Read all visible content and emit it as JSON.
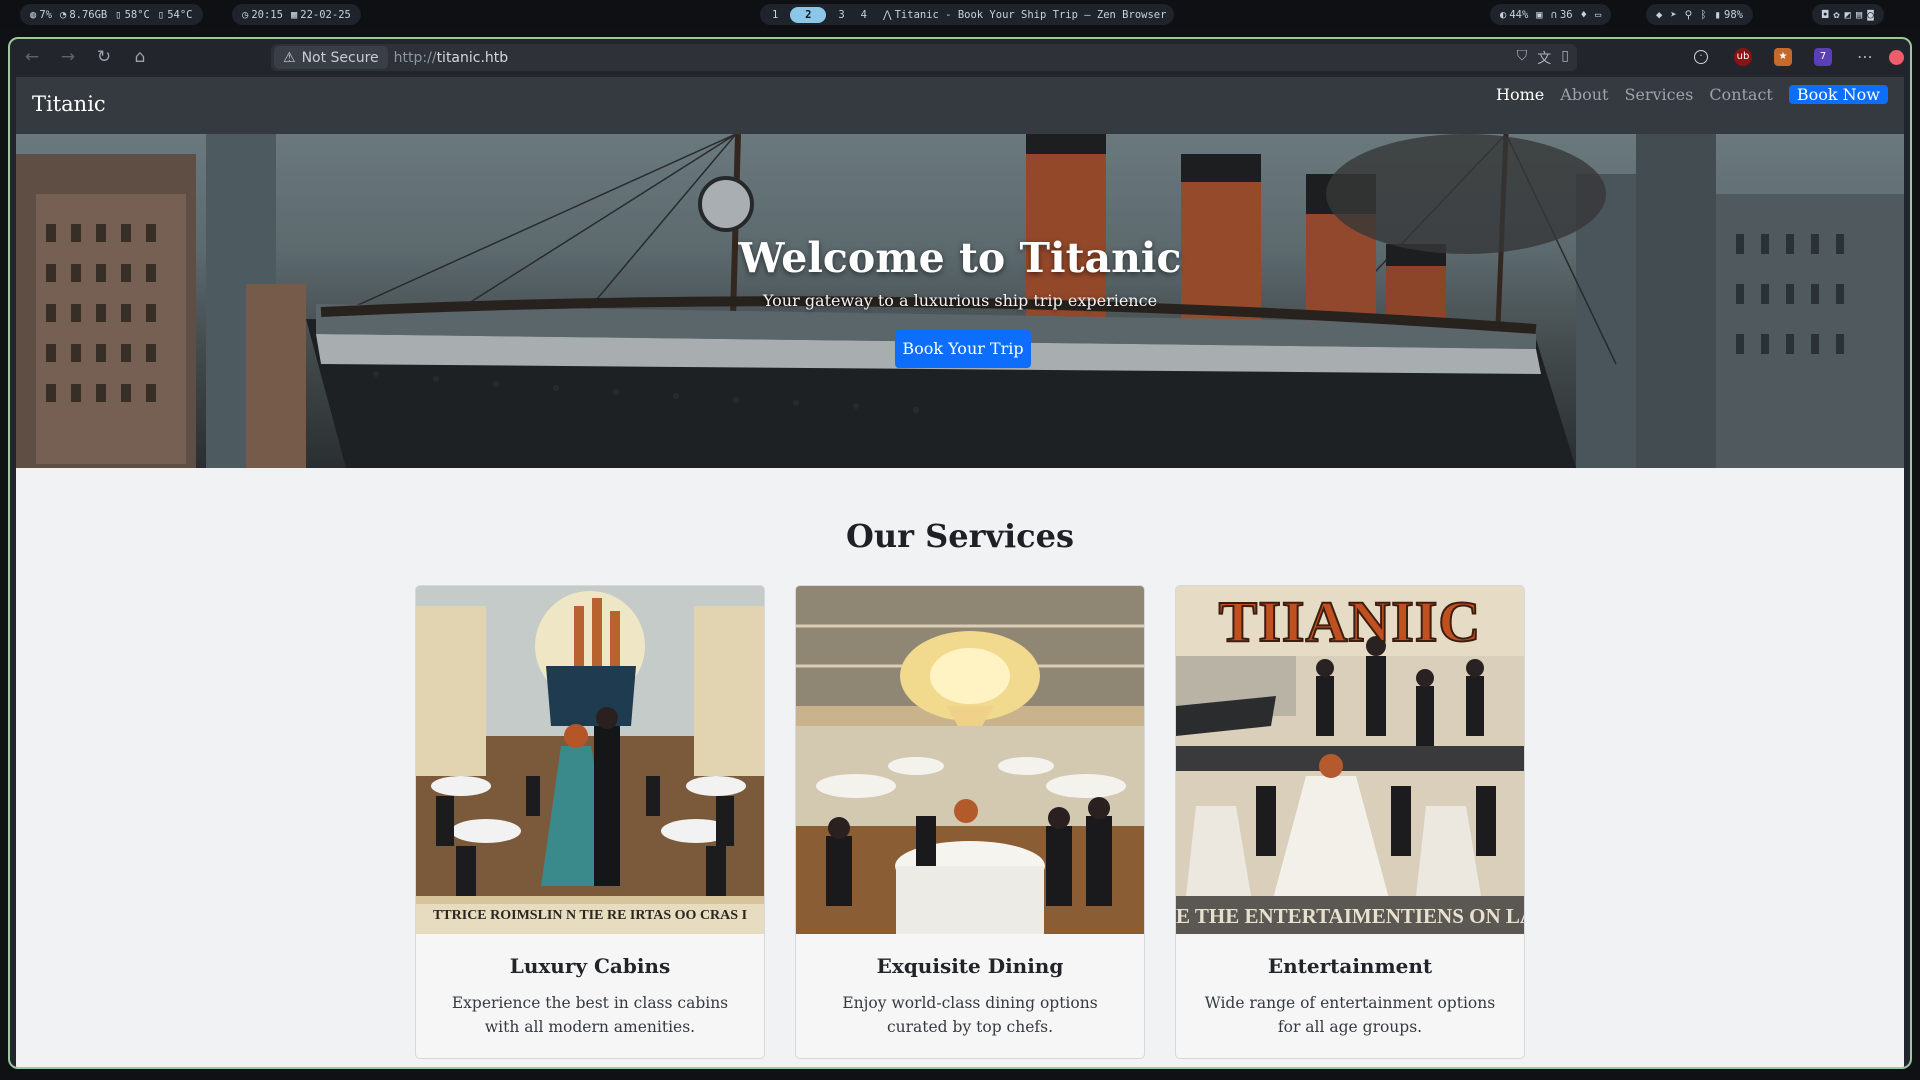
{
  "system_bar": {
    "stats": [
      "7%",
      "8.76GB",
      "58°C",
      "54°C"
    ],
    "clock": "20:15",
    "date": "22-02-25",
    "workspaces": [
      "1",
      "2",
      "3",
      "4"
    ],
    "active_workspace": "2",
    "window_title": "Titanic - Book Your Ship Trip — Zen Browser",
    "right_stats": [
      "44%",
      "36"
    ],
    "battery": "98%"
  },
  "browser": {
    "security_label": "Not Secure",
    "url_prefix": "http://",
    "url_host": "titanic.htb"
  },
  "site": {
    "brand": "Titanic",
    "nav": [
      "Home",
      "About",
      "Services",
      "Contact"
    ],
    "active_nav": "Home",
    "cta": "Book Now"
  },
  "hero": {
    "title": "Welcome to Titanic",
    "subtitle": "Your gateway to a luxurious ship trip experience",
    "button": "Book Your Trip"
  },
  "services": {
    "heading": "Our Services",
    "cards": [
      {
        "title": "Luxury Cabins",
        "text": "Experience the best in class cabins with all modern amenities.",
        "poster_text": "TTRICE ROIMSLIN N TIE RE IRTAS OO CRAS I"
      },
      {
        "title": "Exquisite Dining",
        "text": "Enjoy world-class dining options curated by top chefs."
      },
      {
        "title": "Entertainment",
        "text": "Wide range of entertainment options for all age groups.",
        "poster_title": "TIIANIIC",
        "poster_text": "E THE ENTERTAIMENTIENS ON LA"
      }
    ]
  }
}
